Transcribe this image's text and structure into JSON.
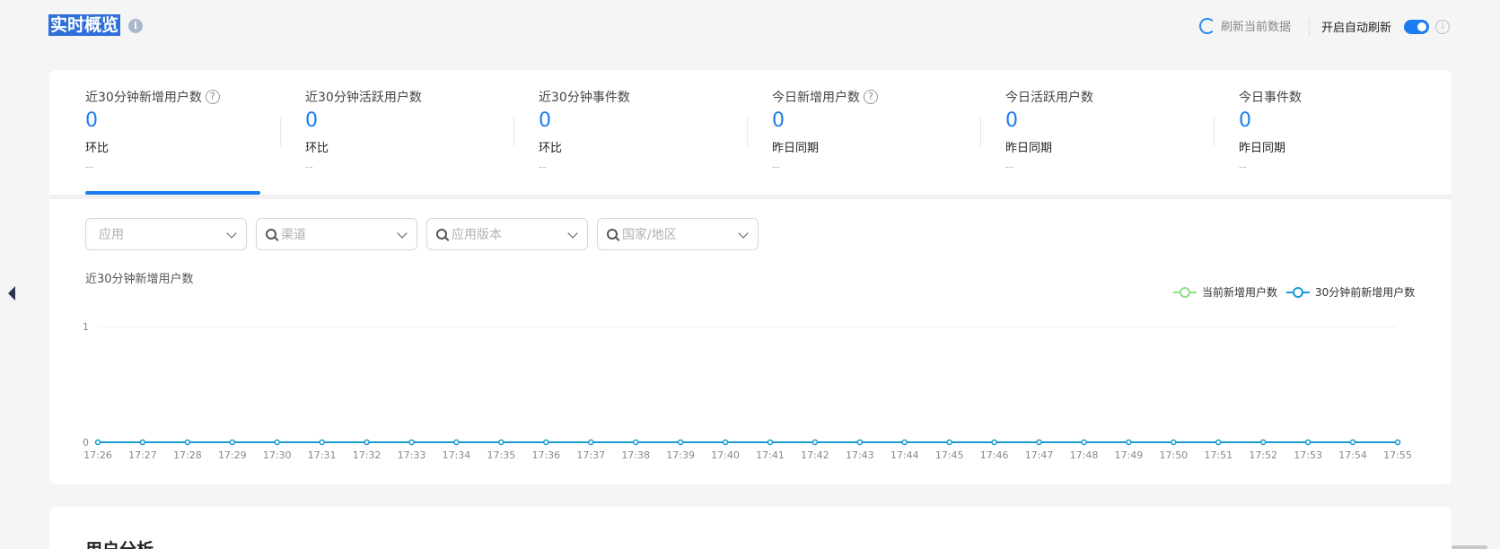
{
  "header": {
    "title": "实时概览",
    "refresh_label": "刷新当前数据",
    "auto_refresh_label": "开启自动刷新",
    "auto_refresh_on": true
  },
  "metrics": [
    {
      "label": "近30分钟新增用户数",
      "value": "0",
      "compare_label": "环比",
      "compare_value": "--",
      "has_help": true
    },
    {
      "label": "近30分钟活跃用户数",
      "value": "0",
      "compare_label": "环比",
      "compare_value": "--",
      "has_help": false
    },
    {
      "label": "近30分钟事件数",
      "value": "0",
      "compare_label": "环比",
      "compare_value": "--",
      "has_help": false
    },
    {
      "label": "今日新增用户数",
      "value": "0",
      "compare_label": "昨日同期",
      "compare_value": "--",
      "has_help": true
    },
    {
      "label": "今日活跃用户数",
      "value": "0",
      "compare_label": "昨日同期",
      "compare_value": "--",
      "has_help": false
    },
    {
      "label": "今日事件数",
      "value": "0",
      "compare_label": "昨日同期",
      "compare_value": "--",
      "has_help": false
    }
  ],
  "filters": [
    {
      "placeholder": "应用",
      "search": false
    },
    {
      "placeholder": "渠道",
      "search": true
    },
    {
      "placeholder": "应用版本",
      "search": true
    },
    {
      "placeholder": "国家/地区",
      "search": true
    }
  ],
  "chart_data": {
    "type": "line",
    "title": "近30分钟新增用户数",
    "x": [
      "17:26",
      "17:27",
      "17:28",
      "17:29",
      "17:30",
      "17:31",
      "17:32",
      "17:33",
      "17:34",
      "17:35",
      "17:36",
      "17:37",
      "17:38",
      "17:39",
      "17:40",
      "17:41",
      "17:42",
      "17:43",
      "17:44",
      "17:45",
      "17:46",
      "17:47",
      "17:48",
      "17:49",
      "17:50",
      "17:51",
      "17:52",
      "17:53",
      "17:54",
      "17:55"
    ],
    "series": [
      {
        "name": "当前新增用户数",
        "color": "#8fe086",
        "values": [
          0,
          0,
          0,
          0,
          0,
          0,
          0,
          0,
          0,
          0,
          0,
          0,
          0,
          0,
          0,
          0,
          0,
          0,
          0,
          0,
          0,
          0,
          0,
          0,
          0,
          0,
          0,
          0,
          0,
          0
        ]
      },
      {
        "name": "30分钟前新增用户数",
        "color": "#1a9bd6",
        "values": [
          0,
          0,
          0,
          0,
          0,
          0,
          0,
          0,
          0,
          0,
          0,
          0,
          0,
          0,
          0,
          0,
          0,
          0,
          0,
          0,
          0,
          0,
          0,
          0,
          0,
          0,
          0,
          0,
          0,
          0
        ]
      }
    ],
    "yticks": [
      "0",
      "1"
    ],
    "ylim": [
      0,
      1
    ],
    "legend": "top-right",
    "grid": true
  },
  "section2": {
    "title": "用户分析"
  },
  "icons": {
    "info": "i",
    "help": "?"
  }
}
